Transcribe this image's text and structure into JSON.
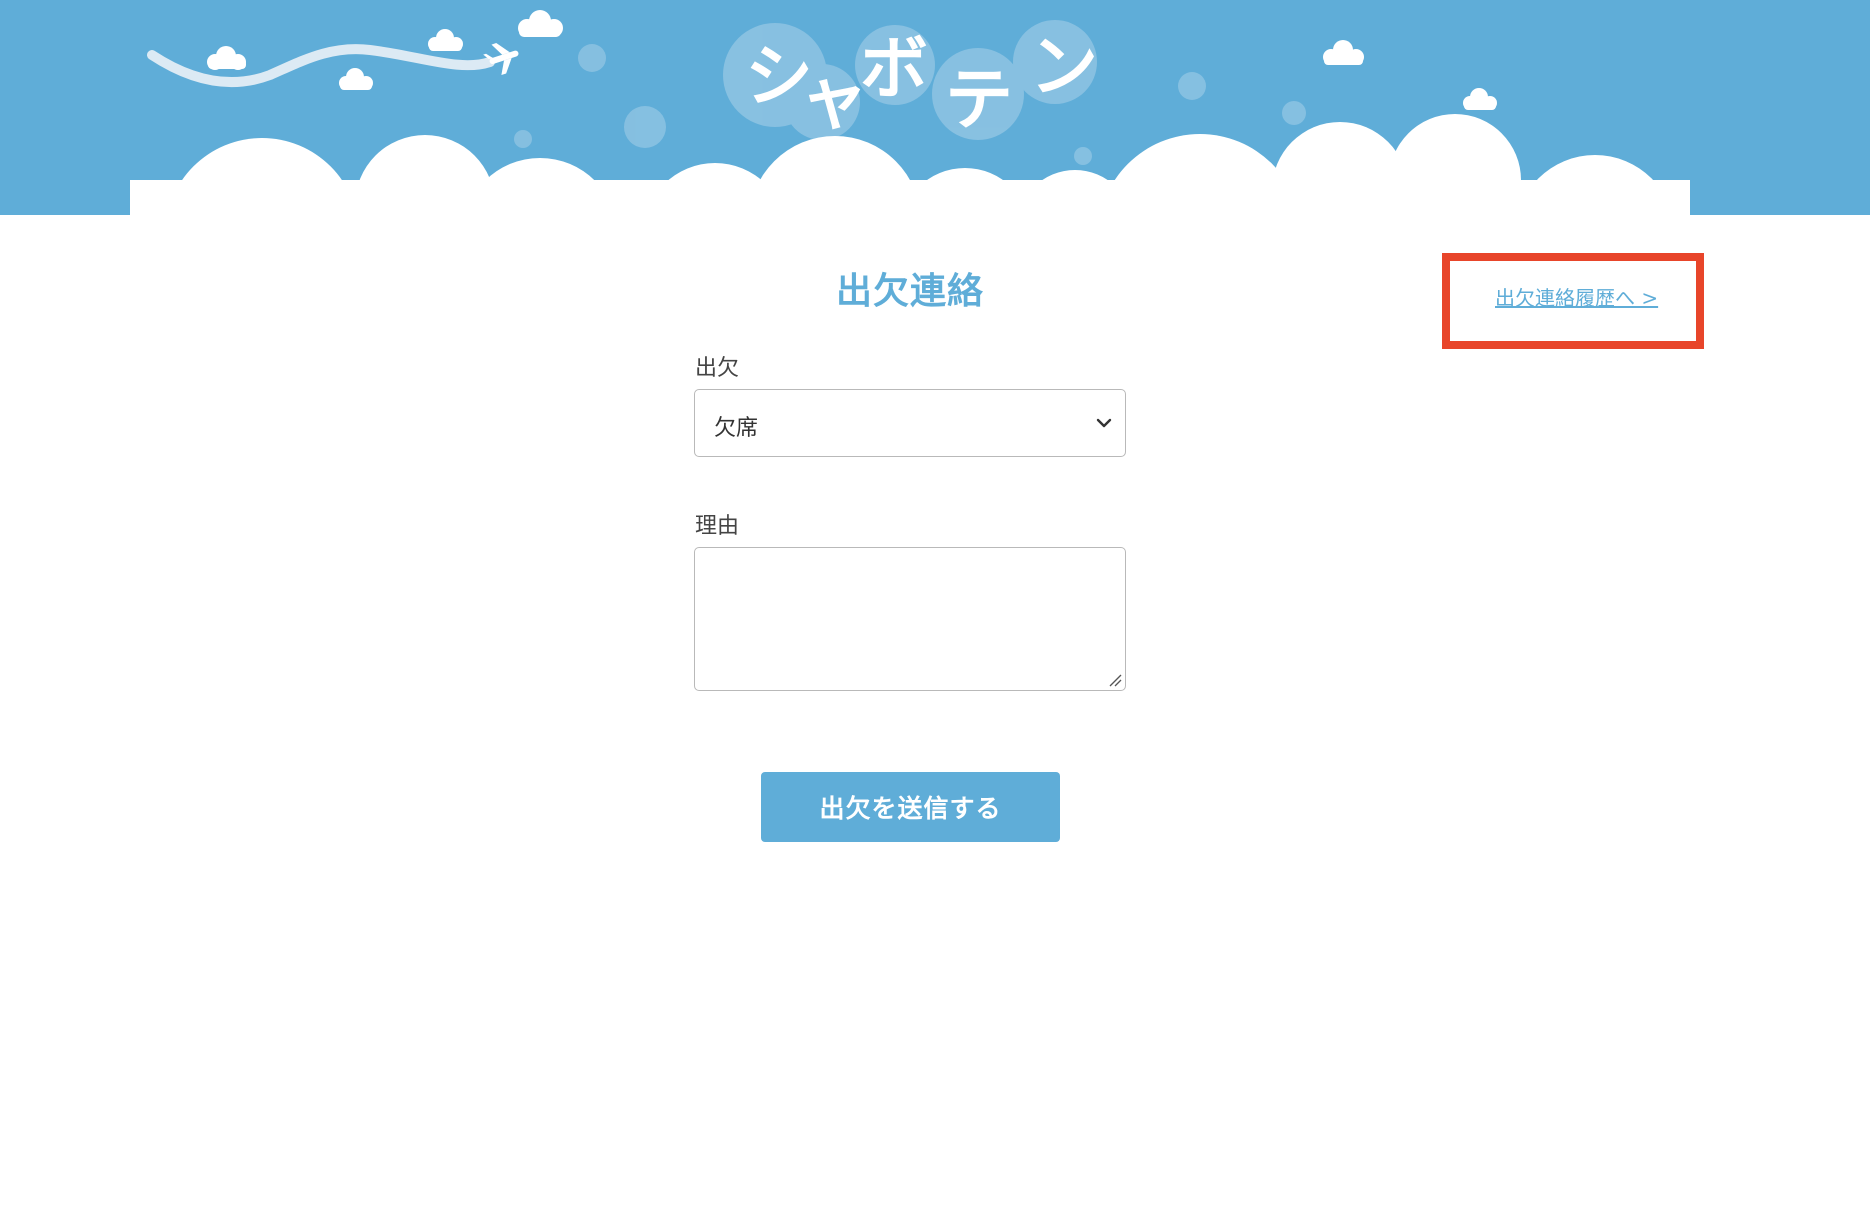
{
  "header": {
    "logo_text": [
      "シ",
      "ャ",
      "ボ",
      "テ",
      "ン"
    ],
    "sky_color": "#5fadd8",
    "cloud_color": "#ffffff"
  },
  "main": {
    "title": "出欠連絡",
    "history_link": "出欠連絡履歴へ >",
    "attendance": {
      "label": "出欠",
      "selected": "欠席"
    },
    "reason": {
      "label": "理由",
      "value": ""
    },
    "submit_label": "出欠を送信する"
  },
  "colors": {
    "accent": "#5fadd8",
    "highlight_border": "#e8452a"
  }
}
